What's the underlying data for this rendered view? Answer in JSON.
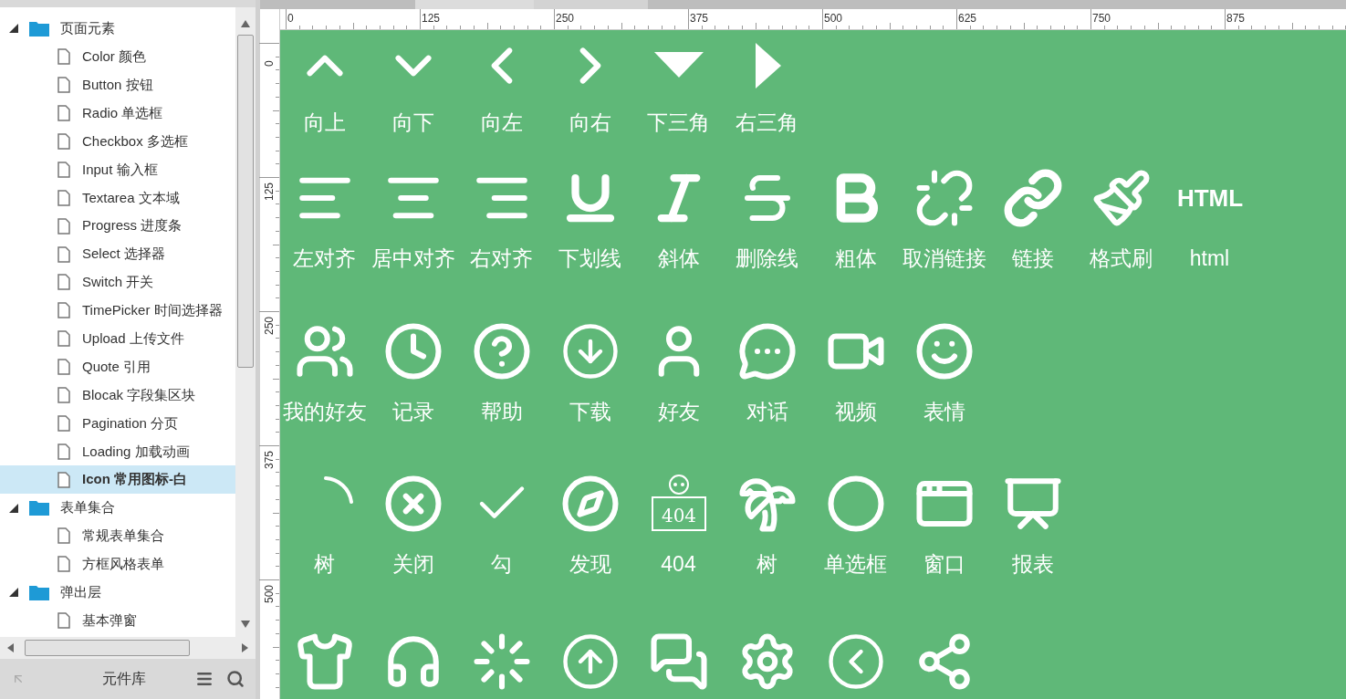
{
  "tree": [
    {
      "label": "页面元素",
      "expanded": true,
      "children": [
        {
          "label": "Color 颜色",
          "selected": false
        },
        {
          "label": "Button 按钮",
          "selected": false
        },
        {
          "label": "Radio 单选框",
          "selected": false
        },
        {
          "label": "Checkbox 多选框",
          "selected": false
        },
        {
          "label": "Input 输入框",
          "selected": false
        },
        {
          "label": "Textarea 文本域",
          "selected": false
        },
        {
          "label": "Progress 进度条",
          "selected": false
        },
        {
          "label": "Select 选择器",
          "selected": false
        },
        {
          "label": "Switch 开关",
          "selected": false
        },
        {
          "label": "TimePicker 时间选择器",
          "selected": false
        },
        {
          "label": "Upload 上传文件",
          "selected": false
        },
        {
          "label": "Quote 引用",
          "selected": false
        },
        {
          "label": "Blocak 字段集区块",
          "selected": false
        },
        {
          "label": "Pagination 分页",
          "selected": false
        },
        {
          "label": "Loading 加载动画",
          "selected": false
        },
        {
          "label": "Icon 常用图标-白",
          "selected": true
        }
      ]
    },
    {
      "label": "表单集合",
      "expanded": true,
      "children": [
        {
          "label": "常规表单集合",
          "selected": false
        },
        {
          "label": "方框风格表单",
          "selected": false
        }
      ]
    },
    {
      "label": "弹出层",
      "expanded": true,
      "children": [
        {
          "label": "基本弹窗",
          "selected": false
        }
      ]
    }
  ],
  "library_bar": {
    "title": "元件库"
  },
  "ruler": {
    "top_labels": [
      "0",
      "125",
      "250",
      "375",
      "500",
      "625",
      "750",
      "875"
    ],
    "left_labels": [
      "0",
      "125",
      "250",
      "375",
      "500"
    ]
  },
  "icon_rows": [
    [
      {
        "kind": "chevron-up",
        "label": "向上"
      },
      {
        "kind": "chevron-down",
        "label": "向下"
      },
      {
        "kind": "chevron-left",
        "label": "向左"
      },
      {
        "kind": "chevron-right",
        "label": "向右"
      },
      {
        "kind": "triangle-down",
        "label": "下三角"
      },
      {
        "kind": "triangle-right",
        "label": "右三角"
      }
    ],
    [
      {
        "kind": "align-left",
        "label": "左对齐"
      },
      {
        "kind": "align-center",
        "label": "居中对齐"
      },
      {
        "kind": "align-right",
        "label": "右对齐"
      },
      {
        "kind": "underline",
        "label": "下划线"
      },
      {
        "kind": "italic",
        "label": "斜体"
      },
      {
        "kind": "strikethrough",
        "label": "删除线"
      },
      {
        "kind": "bold",
        "label": "粗体"
      },
      {
        "kind": "unlink",
        "label": "取消链接"
      },
      {
        "kind": "link",
        "label": "链接"
      },
      {
        "kind": "brush",
        "label": "格式刷"
      },
      {
        "kind": "html",
        "label": "html",
        "icon_text": "HTML"
      }
    ],
    [
      {
        "kind": "users",
        "label": "我的好友"
      },
      {
        "kind": "clock",
        "label": "记录"
      },
      {
        "kind": "question",
        "label": "帮助"
      },
      {
        "kind": "download",
        "label": "下载"
      },
      {
        "kind": "user",
        "label": "好友"
      },
      {
        "kind": "chat",
        "label": "对话"
      },
      {
        "kind": "video",
        "label": "视频"
      },
      {
        "kind": "smile",
        "label": "表情"
      }
    ],
    [
      {
        "kind": "arc",
        "label": "树"
      },
      {
        "kind": "close",
        "label": "关闭"
      },
      {
        "kind": "check",
        "label": "勾"
      },
      {
        "kind": "compass",
        "label": "发现"
      },
      {
        "kind": "notfound",
        "label": "404",
        "icon_text": "404"
      },
      {
        "kind": "palm",
        "label": "树"
      },
      {
        "kind": "circle",
        "label": "单选框"
      },
      {
        "kind": "window",
        "label": "窗口"
      },
      {
        "kind": "chart-board",
        "label": "报表"
      }
    ],
    [
      {
        "kind": "shirt"
      },
      {
        "kind": "headphones"
      },
      {
        "kind": "loader"
      },
      {
        "kind": "upload"
      },
      {
        "kind": "chats"
      },
      {
        "kind": "gear"
      },
      {
        "kind": "back"
      },
      {
        "kind": "share"
      }
    ]
  ]
}
